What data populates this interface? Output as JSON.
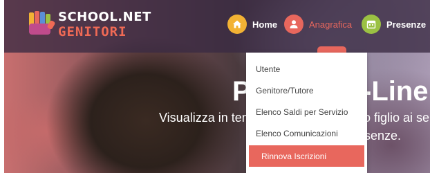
{
  "logo": {
    "line1": "SCHOOL.NET",
    "line2": "GENITORI"
  },
  "nav": {
    "items": [
      {
        "label": "Home",
        "icon": "home-icon",
        "color": "#f2b234",
        "label_color": "#ffffff"
      },
      {
        "label": "Anagrafica",
        "icon": "user-icon",
        "color": "#e8675d",
        "label_color": "#e8675d"
      },
      {
        "label": "Presenze",
        "icon": "calendar-icon",
        "color": "#9bc143",
        "label_color": "#ffffff"
      }
    ]
  },
  "hero": {
    "title": "P                    -Line",
    "title_left": "P",
    "title_right": "-Line",
    "subtitle_line1": "Visualizza in temp",
    "subtitle_line1_right": "o figlio ai serv",
    "subtitle_line2_right": "senze."
  },
  "dropdown": {
    "items": [
      {
        "label": "Utente",
        "active": false
      },
      {
        "label": "Genitore/Tutore",
        "active": false
      },
      {
        "label": "Elenco Saldi per Servizio",
        "active": false
      },
      {
        "label": "Elenco Comunicazioni",
        "active": false
      },
      {
        "label": "Rinnova Iscrizioni",
        "active": true
      }
    ]
  },
  "colors": {
    "accent": "#e8675d",
    "topbar": "#3a2a42",
    "home": "#f2b234",
    "presenze": "#9bc143"
  }
}
